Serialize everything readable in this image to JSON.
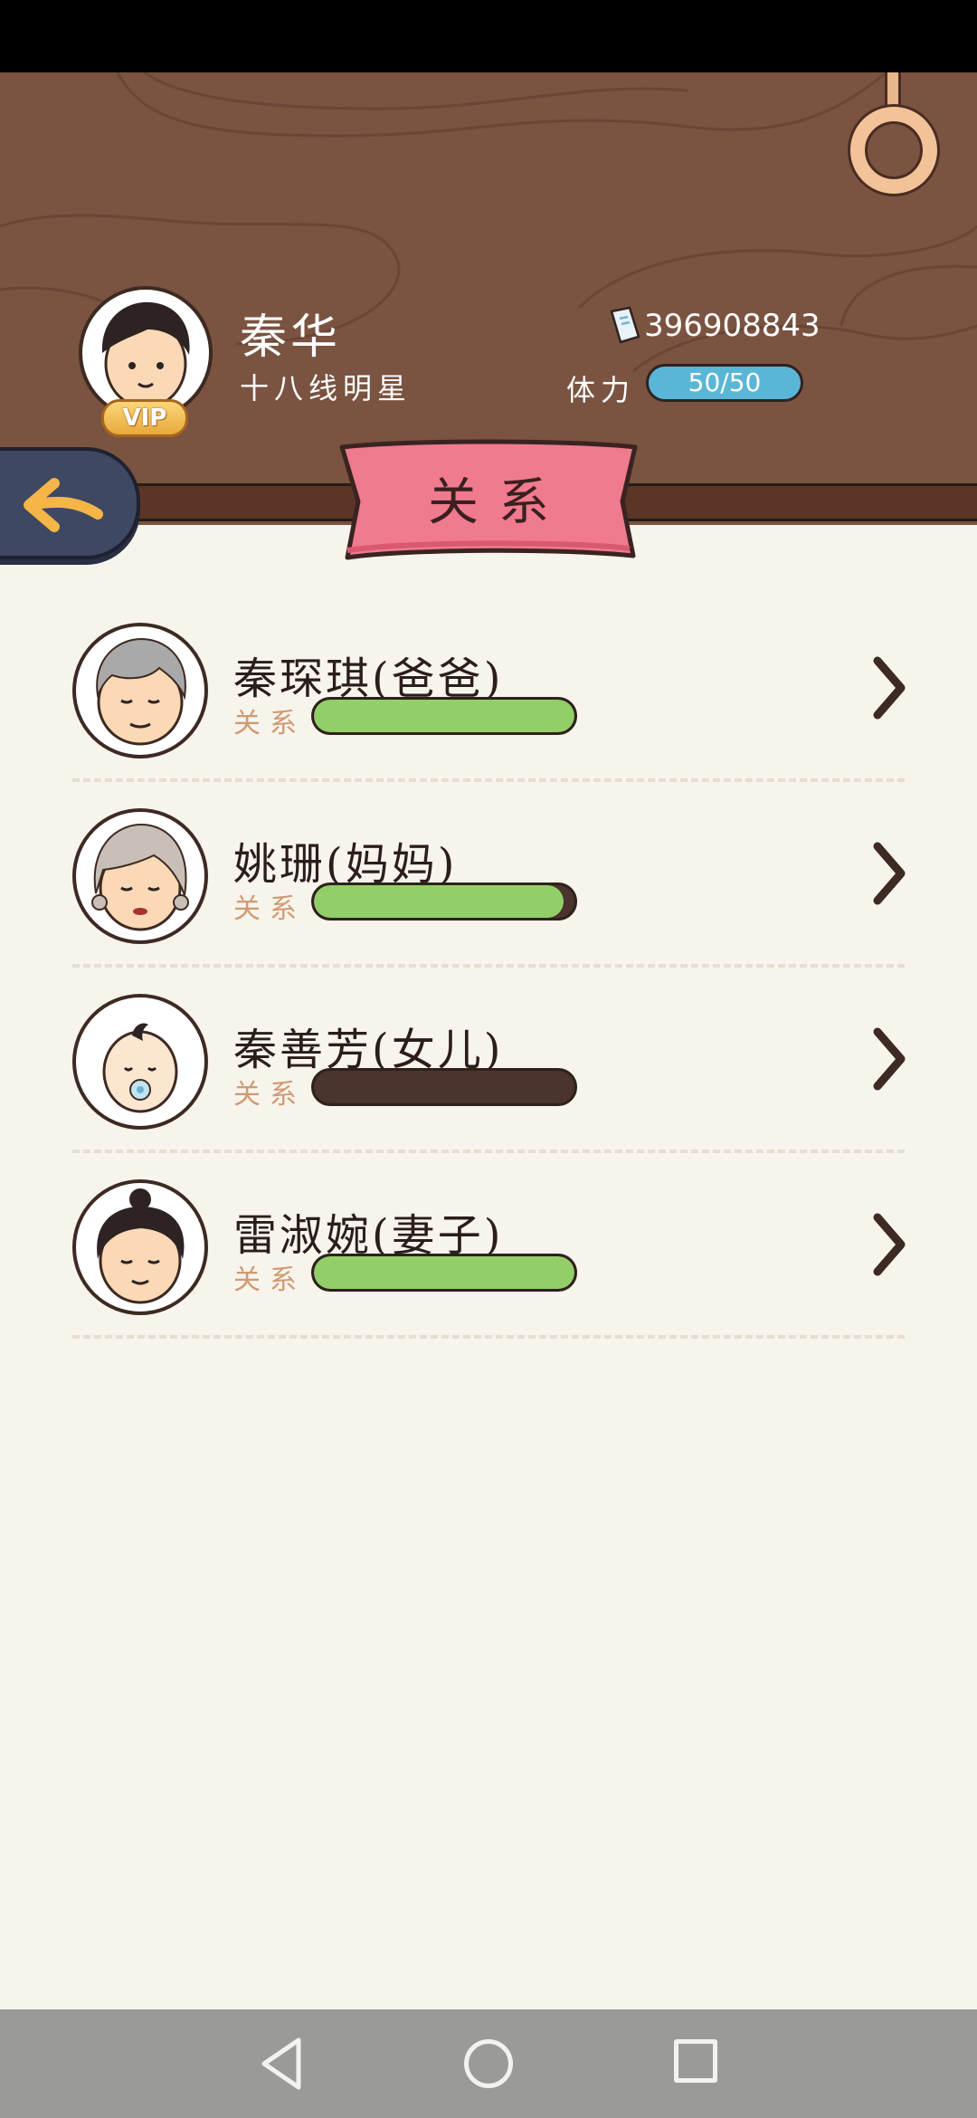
{
  "player": {
    "name": "秦华",
    "title": "十八线明星",
    "vip": "VIP",
    "money": "396908843",
    "stamina_label": "体力",
    "stamina_value": "50/50"
  },
  "banner": {
    "title": "关系"
  },
  "relations": [
    {
      "name": "秦琛琪(爸爸)",
      "rel_label": "关系",
      "level": 1.0
    },
    {
      "name": "姚珊(妈妈)",
      "rel_label": "关系",
      "level": 0.96
    },
    {
      "name": "秦善芳(女儿)",
      "rel_label": "关系",
      "level": 0.0
    },
    {
      "name": "雷淑婉(妻子)",
      "rel_label": "关系",
      "level": 1.0
    }
  ],
  "colors": {
    "header_wood": "#7a5341",
    "banner_pink": "#f07a8e",
    "stamina_blue": "#5ab6d7",
    "relation_green": "#92cf68",
    "back_arrow": "#f5b547"
  },
  "icons": {
    "back": "arrow-left-icon",
    "chevron": "chevron-right-icon",
    "ring": "ring-icon",
    "money": "banknote-icon"
  }
}
